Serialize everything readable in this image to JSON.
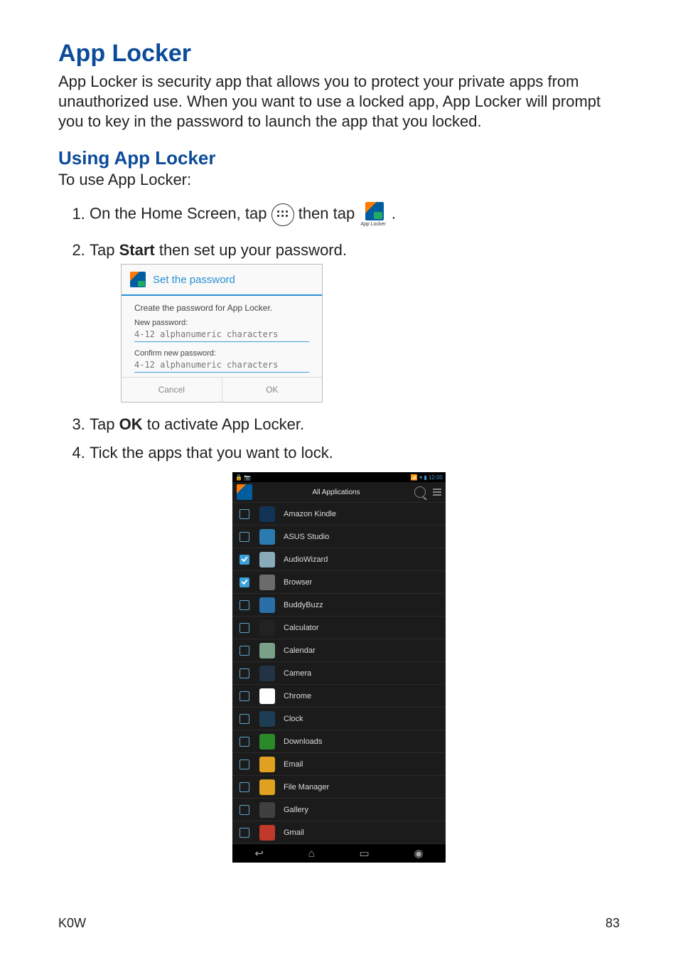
{
  "heading": "App Locker",
  "intro": "App Locker is security app that allows you to protect your private apps from unauthorized use. When you want to use a locked app, App Locker will prompt you to key in the password to launch the app that you locked.",
  "subheading": "Using App Locker",
  "lead": "To use App Locker:",
  "step1_a": "On the Home Screen, tap ",
  "step1_b": " then tap ",
  "step1_c": " .",
  "app_label": "App Locker",
  "step2_a": "Tap ",
  "step2_bold": "Start",
  "step2_b": " then set up your password.",
  "dialog": {
    "title": "Set the password",
    "create": "Create the password for App Locker.",
    "new_label": "New password:",
    "placeholder": "4-12 alphanumeric characters",
    "confirm_label": "Confirm new password:",
    "cancel": "Cancel",
    "ok": "OK"
  },
  "step3_a": "Tap ",
  "step3_bold": "OK",
  "step3_b": " to activate App Locker.",
  "step4": "Tick the apps that you want to lock.",
  "phone": {
    "status_time": "12:00",
    "tab_title": "All Applications",
    "apps": [
      {
        "label": "Amazon Kindle",
        "checked": false,
        "bg": "#113355"
      },
      {
        "label": "ASUS Studio",
        "checked": false,
        "bg": "#2b7bb0"
      },
      {
        "label": "AudioWizard",
        "checked": true,
        "bg": "#88aabb"
      },
      {
        "label": "Browser",
        "checked": true,
        "bg": "#6b6b6b"
      },
      {
        "label": "BuddyBuzz",
        "checked": false,
        "bg": "#2a6fa8"
      },
      {
        "label": "Calculator",
        "checked": false,
        "bg": "#222"
      },
      {
        "label": "Calendar",
        "checked": false,
        "bg": "#7aa088"
      },
      {
        "label": "Camera",
        "checked": false,
        "bg": "#213344"
      },
      {
        "label": "Chrome",
        "checked": false,
        "bg": "#ffffff"
      },
      {
        "label": "Clock",
        "checked": false,
        "bg": "#1c3d54"
      },
      {
        "label": "Downloads",
        "checked": false,
        "bg": "#2a8a2a"
      },
      {
        "label": "Email",
        "checked": false,
        "bg": "#e0a020"
      },
      {
        "label": "File Manager",
        "checked": false,
        "bg": "#e0a020"
      },
      {
        "label": "Gallery",
        "checked": false,
        "bg": "#404040"
      },
      {
        "label": "Gmail",
        "checked": false,
        "bg": "#c0392b"
      }
    ]
  },
  "footer_left": "K0W",
  "footer_right": "83"
}
